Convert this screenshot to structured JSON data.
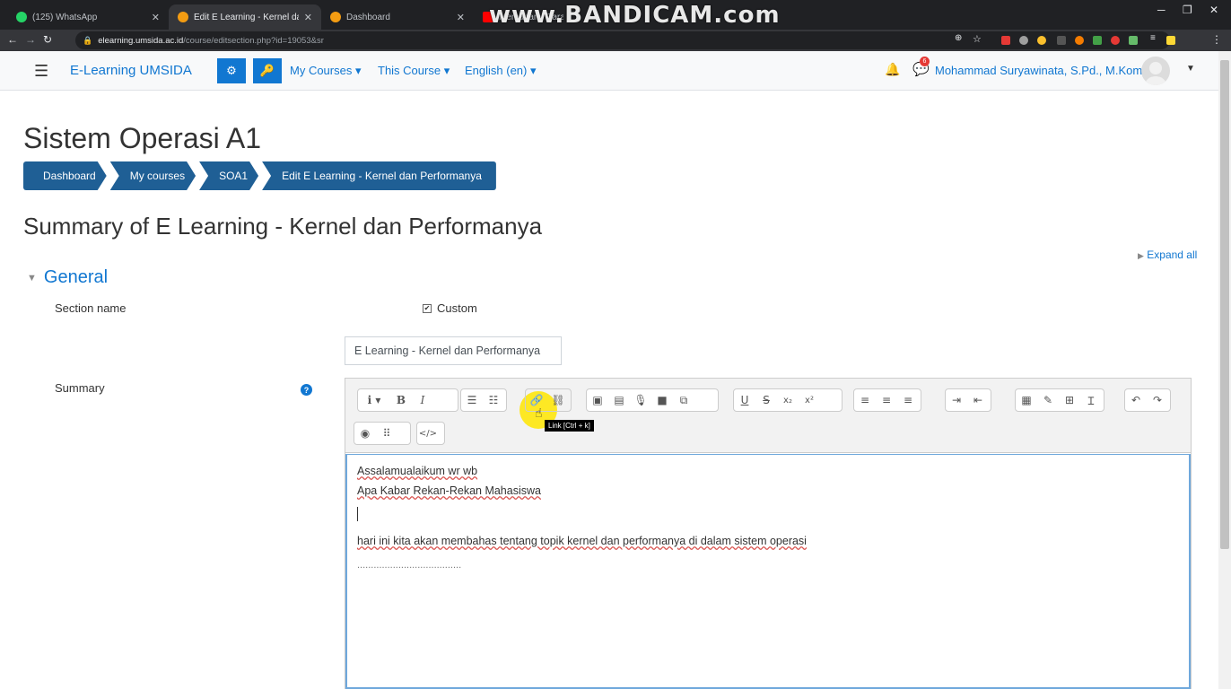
{
  "browser": {
    "tabs": [
      {
        "label": "(125) WhatsApp",
        "fav": "#25d366"
      },
      {
        "label": "Edit E Learning - Kernel dan Perf",
        "fav": "#f39c12"
      },
      {
        "label": "Dashboard",
        "fav": "#f39c12"
      },
      {
        "label": "Memahami Cara K",
        "fav": "#ff0000"
      }
    ],
    "url_host": "elearning.umsida.ac.id",
    "url_path": "/course/editsection.php?id=19053&sr",
    "watermark": "www.BANDICAM.com"
  },
  "navbar": {
    "brand": "E-Learning UMSIDA",
    "my_courses": "My Courses",
    "this_course": "This Course",
    "language": "English (en)",
    "user_name": "Mohammad Suryawinata, S.Pd., M.Kom",
    "chat_badge": "6"
  },
  "page": {
    "course_title": "Sistem Operasi A1",
    "breadcrumb": [
      "Dashboard",
      "My courses",
      "SOA1",
      "Edit E Learning - Kernel dan Performanya"
    ],
    "heading": "Summary of E Learning - Kernel dan Performanya",
    "expand_all": "Expand all",
    "section": "General",
    "section_name_label": "Section name",
    "custom_label": "Custom",
    "section_name_value": "E Learning - Kernel dan Performanya",
    "summary_label": "Summary"
  },
  "editor": {
    "tooltip": "Link [Ctrl + k]",
    "lines": {
      "l1": "Assalamualaikum wr wb",
      "l2": "Apa Kabar Rekan-Rekan Mahasiswa",
      "l3": "hari ini kita akan membahas tentang topik kernel dan performanya di dalam sistem operasi",
      "l4": "......................................"
    }
  }
}
